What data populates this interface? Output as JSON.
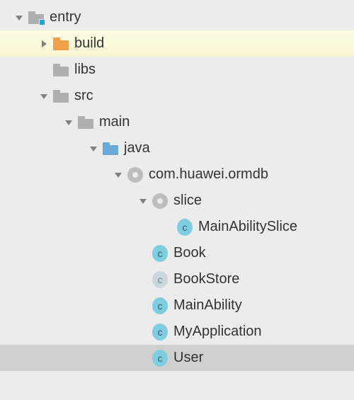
{
  "tree": {
    "entry": "entry",
    "build": "build",
    "libs": "libs",
    "src": "src",
    "main": "main",
    "java": "java",
    "package": "com.huawei.ormdb",
    "slice": "slice",
    "mainAbilitySlice": "MainAbilitySlice",
    "book": "Book",
    "bookStore": "BookStore",
    "mainAbility": "MainAbility",
    "myApplication": "MyApplication",
    "user": "User"
  },
  "classBadge": "c"
}
